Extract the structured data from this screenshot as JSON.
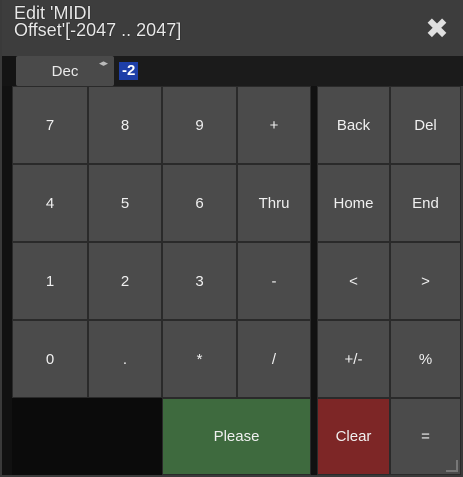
{
  "dialog": {
    "title": "Edit 'MIDI\nOffset'[-2047 .. 2047]",
    "close_glyph": "✖"
  },
  "input": {
    "mode_label": "Dec",
    "mode_arrows": "◂▸",
    "value": "-2"
  },
  "keys": {
    "k7": "7",
    "k8": "8",
    "k9": "9",
    "plus": "+",
    "k4": "4",
    "k5": "5",
    "k6": "6",
    "thru": "Thru",
    "k1": "1",
    "k2": "2",
    "k3": "3",
    "minus": "-",
    "k0": "0",
    "dot": ".",
    "star": "*",
    "slash": "/",
    "please": "Please",
    "back": "Back",
    "del": "Del",
    "home": "Home",
    "end": "End",
    "left": "<",
    "right": ">",
    "plusminus": "+/-",
    "percent": "%",
    "clear": "Clear",
    "equals": "="
  },
  "colors": {
    "please_bg": "#3e6a3e",
    "clear_bg": "#7d2626",
    "value_highlight": "#1e3fa8"
  }
}
